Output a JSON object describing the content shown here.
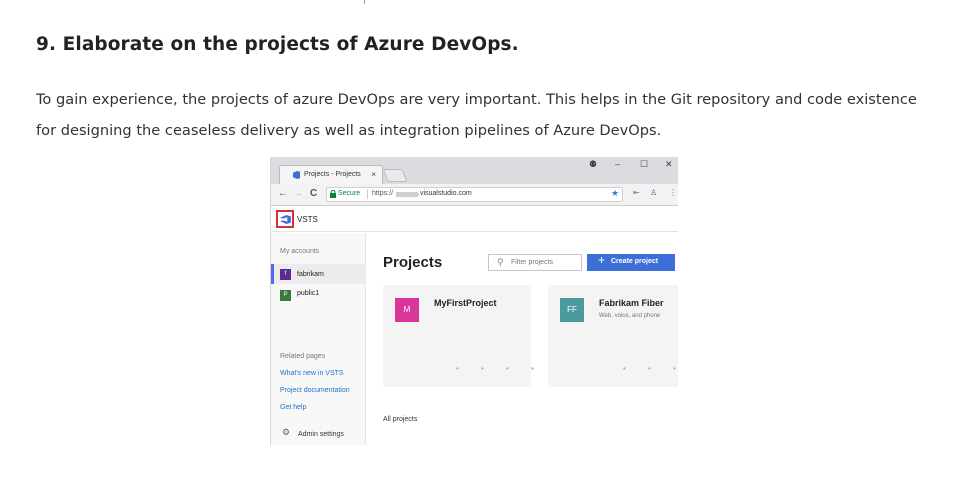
{
  "article": {
    "heading": "9. Elaborate on the projects of Azure DevOps.",
    "body": "To gain experience, the projects of azure DevOps are very important. This helps in the Git repository and code existence for designing the ceaseless delivery as well as integration pipelines of Azure DevOps."
  },
  "browser": {
    "tab_title": "Projects - Projects",
    "tab_close": "×",
    "window_controls": {
      "account": "⚉",
      "minimize": "–",
      "maximize": "☐",
      "close": "✕"
    },
    "nav": {
      "back": "←",
      "forward": "→",
      "reload": "C"
    },
    "secure_label": "Secure",
    "url_prefix": "https://",
    "url_suffix": ".visualstudio.com",
    "star": "★"
  },
  "vsts": {
    "app_name": "VSTS",
    "brand_color": "#3e6fd8",
    "sidebar": {
      "accounts_heading": "My accounts",
      "accounts": [
        {
          "initial": "f",
          "label": "fabrikam",
          "color": "#5c2d91",
          "active": true
        },
        {
          "initial": "P",
          "label": "public1",
          "color": "#3a7a3a",
          "active": false
        }
      ],
      "related_heading": "Related pages",
      "links": [
        "What's new in VSTS",
        "Project documentation",
        "Get help"
      ],
      "admin_label": "Admin settings"
    },
    "main": {
      "title": "Projects",
      "filter_placeholder": "Filter projects",
      "create_label": "Create project",
      "projects": [
        {
          "initials": "M",
          "name": "MyFirstProject",
          "description": "",
          "color": "#d9359b"
        },
        {
          "initials": "FF",
          "name": "Fabrikam Fiber",
          "description": "Web, voice, and phone",
          "color": "#4a9a9e"
        }
      ],
      "dots": "• • • •",
      "all_projects_label": "All projects"
    }
  }
}
